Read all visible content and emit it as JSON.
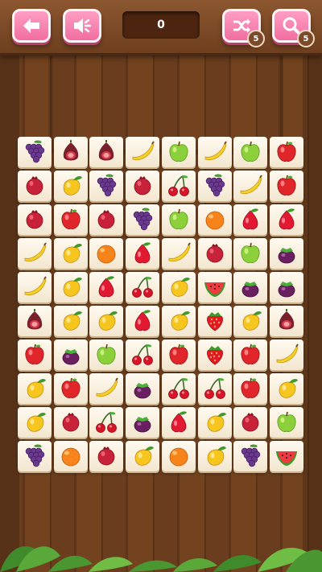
{
  "header": {
    "back_icon": "back-arrow-icon",
    "sound_icon": "speaker-icon",
    "score": "0",
    "shuffle_icon": "shuffle-icon",
    "shuffle_count": "5",
    "hint_icon": "magnifier-icon",
    "hint_count": "5"
  },
  "colors": {
    "button_pink": "#f06ea0",
    "topbar_wood": "#7a4826",
    "tile_face": "#fbf2e2"
  },
  "board": {
    "rows": 10,
    "cols": 8,
    "tiles": [
      [
        "grapes",
        "fig",
        "fig",
        "banana",
        "green-apple",
        "banana",
        "green-apple",
        "red-apple"
      ],
      [
        "pomegranate",
        "mango",
        "grapes",
        "pomegranate",
        "cherries",
        "grapes",
        "banana",
        "red-apple"
      ],
      [
        "pomegranate",
        "red-apple",
        "pomegranate",
        "grapes",
        "green-apple",
        "orange",
        "rose-apple",
        "rose-apple"
      ],
      [
        "banana",
        "mango",
        "orange",
        "rose-apple",
        "banana",
        "pomegranate",
        "green-apple",
        "mangosteen"
      ],
      [
        "banana",
        "mango",
        "rose-apple",
        "cherries",
        "mango",
        "watermelon",
        "mangosteen",
        "mangosteen"
      ],
      [
        "fig",
        "mango",
        "mango",
        "rose-apple",
        "mango",
        "strawberry",
        "mango",
        "fig"
      ],
      [
        "red-apple",
        "mangosteen",
        "green-apple",
        "cherries",
        "red-apple",
        "strawberry",
        "red-apple",
        "banana"
      ],
      [
        "mango",
        "red-apple",
        "banana",
        "mangosteen",
        "cherries",
        "cherries",
        "red-apple",
        "mango"
      ],
      [
        "mango",
        "pomegranate",
        "cherries",
        "mangosteen",
        "rose-apple",
        "mango",
        "pomegranate",
        "green-apple"
      ],
      [
        "grapes",
        "orange",
        "pomegranate",
        "mango",
        "orange",
        "mango",
        "grapes",
        "watermelon"
      ]
    ]
  }
}
